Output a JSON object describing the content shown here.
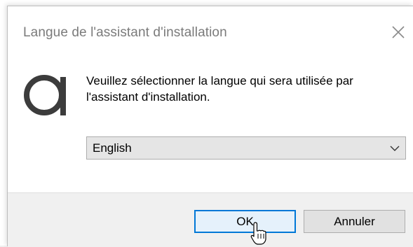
{
  "dialog": {
    "title": "Langue de l'assistant d'installation",
    "close_icon": "close-icon",
    "logo_icon": "app-logo-icon",
    "message": "Veuillez sélectionner la langue qui sera utilisée par l'assistant d'installation.",
    "language_select": {
      "selected": "English",
      "chevron_icon": "chevron-down-icon"
    },
    "buttons": {
      "ok_label": "OK",
      "cancel_label": "Annuler"
    }
  },
  "cursor_icon": "hand-pointer-cursor-icon",
  "colors": {
    "title_text": "#7b7b7b",
    "footer_bg": "#f0f0f0",
    "default_button_border": "#0078d7",
    "default_button_bg": "#e5f1fb",
    "select_bg": "#e5e5e5"
  }
}
